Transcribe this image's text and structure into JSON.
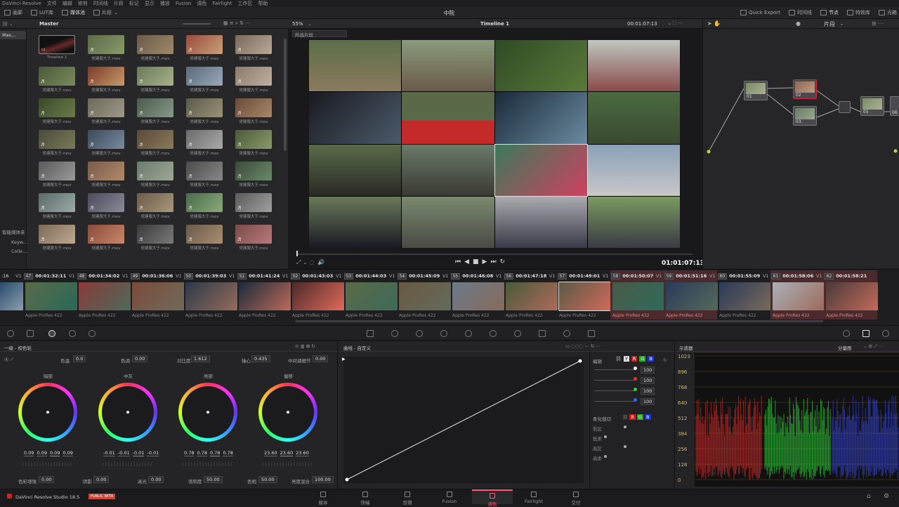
{
  "menu": [
    "DaVinci Resolve",
    "文件",
    "编辑",
    "修剪",
    "时间线",
    "片段",
    "标记",
    "显示",
    "播放",
    "Fusion",
    "调色",
    "Fairlight",
    "工作区",
    "帮助"
  ],
  "topbar": {
    "media_pool": "画廊",
    "lut": "LUT库",
    "media": "媒体池",
    "clips": "片段",
    "project": "中院",
    "quick_export": "Quick Export",
    "timeline": "时间线",
    "nodes": "节点",
    "effects": "特效库",
    "lightbox": "光箱"
  },
  "pool": {
    "title": "Master",
    "sidebar_master": "Mas...",
    "smart_bins": "智能媒体夹",
    "keywords": "Keyw...",
    "collections": "Colle...",
    "clips": [
      "Timeline 1",
      "党建服大于.mov",
      "党建服大于.mov",
      "党建服大于.mov",
      "党建服大于.mov",
      "党建服大于.mov",
      "党建服大于.mov",
      "党建服大于.mov",
      "党建服大于.mov",
      "党建服大于.mov",
      "党建服大于.mov",
      "党建服大于.mov",
      "党建服大于.mov",
      "党建服大于.mov",
      "党建服大于.mov",
      "党建服大于.mov",
      "党建服大于.mov",
      "党建服大于.mov",
      "党建服大于.mov",
      "党建服大于.mov",
      "党建服大于.mov",
      "党建服大于.mov",
      "党建服大于.mov",
      "党建服大于.mov",
      "党建服大于.mov",
      "党建服大于.mov",
      "党建服大于.mov",
      "党建服大于.mov",
      "党建服大于.mov",
      "党建服大于.mov",
      "党建服大于.mov",
      "党建服大于.mov",
      "党建服大于.mov",
      "党建服大于.mov",
      "党建服大于.mov",
      "党建服大于.mov"
    ]
  },
  "viewer": {
    "zoom": "55%",
    "timeline_name": "Timeline 1",
    "timecode_top": "00:01:07:13",
    "clip_dropdown": "所选片段",
    "timecode": "01:01:07:13"
  },
  "nodes_panel": {
    "mode": "片段",
    "node_labels": [
      "01",
      "02",
      "03",
      "05",
      "06"
    ]
  },
  "timeline": [
    {
      "n": "47",
      "tc": "00:01:32:11",
      "v": "V1"
    },
    {
      "n": "48",
      "tc": "00:01:34:02",
      "v": "V1"
    },
    {
      "n": "49",
      "tc": "00:01:36:06",
      "v": "V1"
    },
    {
      "n": "50",
      "tc": "00:01:39:03",
      "v": "V1"
    },
    {
      "n": "51",
      "tc": "00:01:41:24",
      "v": "V1"
    },
    {
      "n": "52",
      "tc": "00:01:43:03",
      "v": "V1"
    },
    {
      "n": "53",
      "tc": "00:01:44:03",
      "v": "V1"
    },
    {
      "n": "54",
      "tc": "00:01:45:09",
      "v": "V1"
    },
    {
      "n": "55",
      "tc": "00:01:46:08",
      "v": "V1"
    },
    {
      "n": "56",
      "tc": "00:01:47:18",
      "v": "V1"
    },
    {
      "n": "57",
      "tc": "00:01:49:01",
      "v": "V1"
    },
    {
      "n": "58",
      "tc": "00:01:50:07",
      "v": "V1"
    },
    {
      "n": "59",
      "tc": "00:01:51:16",
      "v": "V1"
    },
    {
      "n": "60",
      "tc": "00:01:55:09",
      "v": "V1"
    },
    {
      "n": "61",
      "tc": "00:01:58:06",
      "v": "V1"
    },
    {
      "n": "62",
      "tc": "00:01:58:21",
      "v": "V1"
    }
  ],
  "timeline_first_tc": ":16",
  "codec": "Apple ProRes 422",
  "wheels": {
    "title": "一级 - 校色轮",
    "temp_label": "色温",
    "temp": "0.0",
    "tint_label": "色调",
    "tint": "0.00",
    "contrast_label": "对比度",
    "contrast": "1.612",
    "pivot_label": "轴心",
    "pivot": "0.435",
    "mid_label": "中间调细节",
    "mid": "0.00",
    "lift": {
      "name": "暗部",
      "v": [
        "0.09",
        "0.09",
        "0.09",
        "0.09"
      ]
    },
    "gamma": {
      "name": "中灰",
      "v": [
        "-0.01",
        "-0.01",
        "-0.01",
        "-0.01"
      ]
    },
    "gain": {
      "name": "亮部",
      "v": [
        "0.78",
        "0.78",
        "0.78",
        "0.78"
      ]
    },
    "offset": {
      "name": "偏移",
      "v": [
        "23.60",
        "23.60",
        "23.60"
      ]
    },
    "color_boost_label": "色彩增强",
    "color_boost": "0.00",
    "shadows_label": "阴影",
    "shadows": "0.00",
    "highlights_label": "高光",
    "highlights": "0.00",
    "sat_label": "饱和度",
    "sat": "50.00",
    "hue_label": "色相",
    "hue": "50.00",
    "lum_mix_label": "亮度混合",
    "lum_mix": "100.00"
  },
  "curves": {
    "title": "曲线 - 自定义",
    "edit_label": "编辑",
    "channels": [
      "Y",
      "R",
      "G",
      "B"
    ],
    "intensity": [
      "100",
      "100",
      "100",
      "100"
    ],
    "soft_clip_label": "柔化裁切",
    "soft_rows": [
      "低区",
      "低柔",
      "高区",
      "高柔"
    ]
  },
  "scope": {
    "title": "示波器",
    "mode": "分量图",
    "ticks": [
      "1023",
      "896",
      "768",
      "640",
      "512",
      "384",
      "256",
      "128",
      "0"
    ]
  },
  "pages": [
    "媒体",
    "快编",
    "剪辑",
    "Fusion",
    "调色",
    "Fairlight",
    "交付"
  ],
  "brand": "DaVinci Resolve Studio 18.5",
  "beta": "PUBLIC BETA"
}
